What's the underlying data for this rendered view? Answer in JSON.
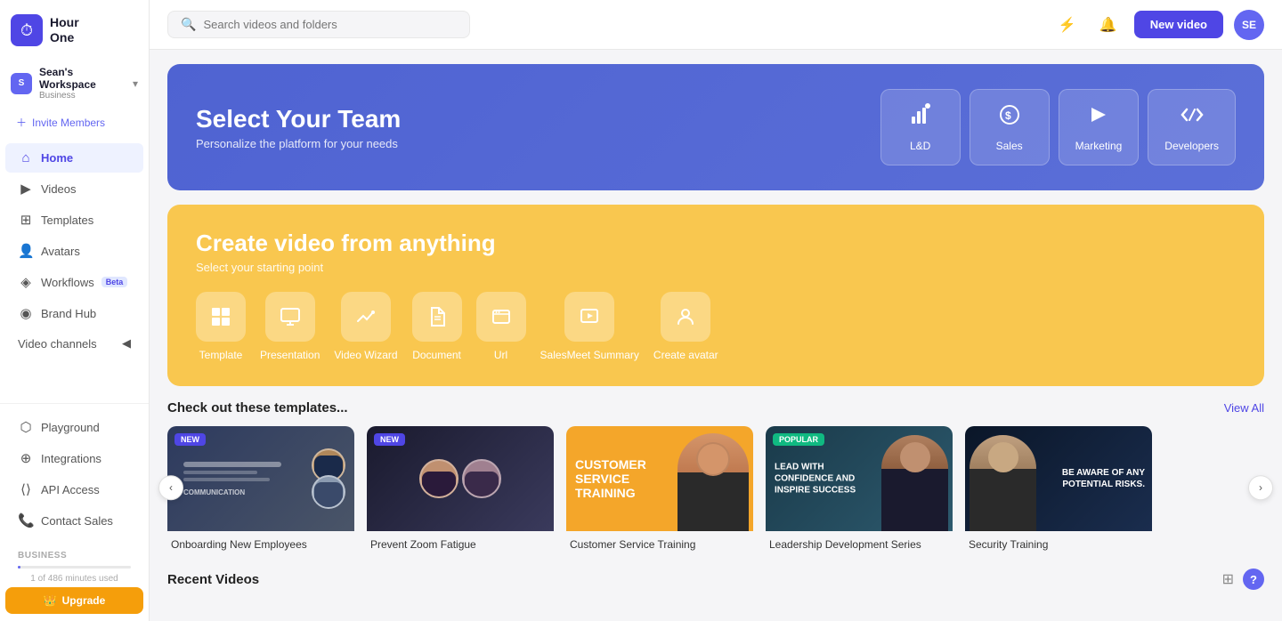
{
  "app": {
    "logo_text": "Hour One",
    "logo_icon": "⏱"
  },
  "sidebar": {
    "workspace": {
      "initial": "S",
      "name": "Sean's Workspace",
      "type": "Business"
    },
    "invite_label": "Invite Members",
    "nav_items": [
      {
        "id": "home",
        "label": "Home",
        "icon": "⌂",
        "active": true
      },
      {
        "id": "videos",
        "label": "Videos",
        "icon": "▶"
      },
      {
        "id": "templates",
        "label": "Templates",
        "icon": "⊞"
      },
      {
        "id": "avatars",
        "label": "Avatars",
        "icon": "👤"
      },
      {
        "id": "workflows",
        "label": "Workflows",
        "icon": "◈",
        "badge": "Beta"
      },
      {
        "id": "brand-hub",
        "label": "Brand Hub",
        "icon": "◉"
      },
      {
        "id": "video-channels",
        "label": "Video channels",
        "icon": ""
      }
    ],
    "bottom_items": [
      {
        "id": "playground",
        "label": "Playground",
        "icon": "🎮"
      },
      {
        "id": "integrations",
        "label": "Integrations",
        "icon": "🔗"
      },
      {
        "id": "api-access",
        "label": "API Access",
        "icon": "⟨⟩"
      },
      {
        "id": "contact-sales",
        "label": "Contact Sales",
        "icon": "📞"
      }
    ],
    "section_label": "BUSINESS",
    "upgrade_label": "Upgrade",
    "minutes_text": "1 of 486 minutes used"
  },
  "topbar": {
    "search_placeholder": "Search videos and folders",
    "new_video_label": "New video",
    "user_initial": "SE"
  },
  "team_banner": {
    "title": "Select Your Team",
    "subtitle": "Personalize the platform for your needs",
    "cards": [
      {
        "id": "ld",
        "label": "L&D",
        "icon": "📊"
      },
      {
        "id": "sales",
        "label": "Sales",
        "icon": "💰"
      },
      {
        "id": "marketing",
        "label": "Marketing",
        "icon": "📢"
      },
      {
        "id": "developers",
        "label": "Developers",
        "icon": "⟨/⟩"
      }
    ]
  },
  "create_banner": {
    "title": "Create video from anything",
    "subtitle": "Select your starting point",
    "tools": [
      {
        "id": "template",
        "label": "Template",
        "icon": "⊞"
      },
      {
        "id": "presentation",
        "label": "Presentation",
        "icon": "📑"
      },
      {
        "id": "video-wizard",
        "label": "Video Wizard",
        "icon": "✏"
      },
      {
        "id": "document",
        "label": "Document",
        "icon": "📄"
      },
      {
        "id": "url",
        "label": "Url",
        "icon": "🔗"
      },
      {
        "id": "salesmeet",
        "label": "SalesMeet Summary",
        "icon": "🎬"
      },
      {
        "id": "create-avatar",
        "label": "Create avatar",
        "icon": "👤"
      }
    ]
  },
  "templates_section": {
    "title": "Check out these templates...",
    "view_all": "View All",
    "items": [
      {
        "id": "onboarding",
        "label": "Onboarding New Employees",
        "badge": "New",
        "badge_type": "new",
        "bg": "onboarding"
      },
      {
        "id": "zoom",
        "label": "Prevent Zoom Fatigue",
        "badge": "New",
        "badge_type": "new",
        "bg": "zoom"
      },
      {
        "id": "customer",
        "label": "Customer Service Training",
        "badge": null,
        "bg": "customer"
      },
      {
        "id": "leadership",
        "label": "Leadership Development Series",
        "badge": "Popular",
        "badge_type": "popular",
        "bg": "leadership"
      },
      {
        "id": "security",
        "label": "Security Training",
        "badge": null,
        "bg": "security"
      }
    ]
  },
  "recent_section": {
    "title": "Recent Videos"
  },
  "customer_thumb_text": "CUSTOMER SERVICE TRAINING",
  "leadership_thumb_text": "LEAD WITH CONFIDENCE AND INSPIRE SUCCESS",
  "security_thumb_text": "BE AWARE OF ANY POTENTIAL RISKS."
}
